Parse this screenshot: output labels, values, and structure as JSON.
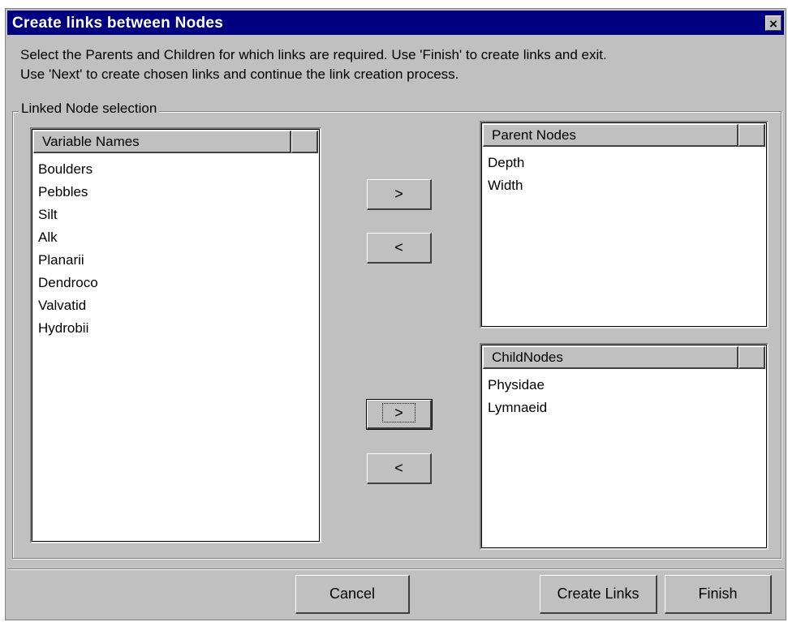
{
  "dialog": {
    "title": "Create links between Nodes",
    "close_label": "×",
    "instructions_line1": "Select the Parents and Children for which links are required. Use 'Finish' to  create links and exit.",
    "instructions_line2": "Use 'Next' to create chosen links and continue the link creation process."
  },
  "group": {
    "label": "Linked Node selection"
  },
  "variables": {
    "header": "Variable Names",
    "items": [
      "Boulders",
      "Pebbles",
      "Silt",
      "Alk",
      "Planarii",
      "Dendroco",
      "Valvatid",
      "Hydrobii"
    ]
  },
  "parents": {
    "header": "Parent Nodes",
    "items": [
      "Depth",
      "Width"
    ],
    "add_label": ">",
    "remove_label": "<"
  },
  "children": {
    "header": "ChildNodes",
    "items": [
      "Physidae",
      "Lymnaeid"
    ],
    "add_label": ">",
    "remove_label": "<"
  },
  "footer": {
    "cancel_label": "Cancel",
    "create_links_label": "Create Links",
    "finish_label": "Finish"
  }
}
